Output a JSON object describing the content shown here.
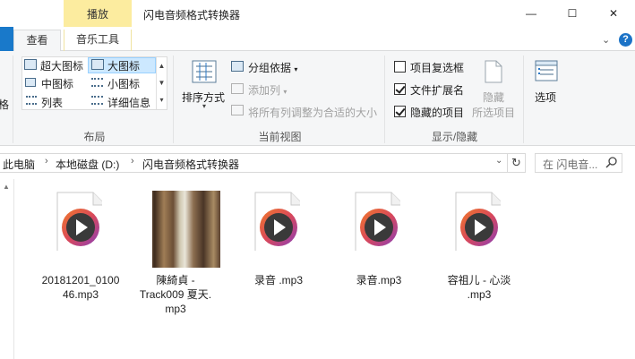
{
  "window": {
    "title": "闪电音频格式转换器",
    "context_tab": "播放",
    "min_symbol": "—",
    "max_symbol": "☐",
    "close_symbol": "✕"
  },
  "tabs": [
    {
      "label": "查看"
    },
    {
      "label": "音乐工具"
    }
  ],
  "ribbon": {
    "layout": {
      "label": "布局",
      "views": [
        "超大图标",
        "大图标",
        "中图标",
        "小图标",
        "列表",
        "详细信息"
      ],
      "selected": "大图标"
    },
    "current_view": {
      "label": "当前视图",
      "sort_by": "排序方式",
      "group_by": "分组依据",
      "add_column": "添加列",
      "fit_columns": "将所有列调整为合适的大小"
    },
    "show_hide": {
      "label": "显示/隐藏",
      "item_checkboxes": {
        "text": "项目复选框",
        "checked": false
      },
      "file_extensions": {
        "text": "文件扩展名",
        "checked": true
      },
      "hidden_items": {
        "text": "隐藏的项目",
        "checked": true
      },
      "hide_selected_line1": "隐藏",
      "hide_selected_line2": "所选项目"
    },
    "options": "选项",
    "left_cut_text": "格"
  },
  "address": {
    "crumbs": [
      "此电脑",
      "本地磁盘 (D:)",
      "闪电音频格式转换器"
    ],
    "search_placeholder": "在 闪电音..."
  },
  "files": [
    {
      "line1": "20181201_0100",
      "line2": "46.mp3",
      "line3": "",
      "type": "audio"
    },
    {
      "line1": "陳綺貞 -",
      "line2": "Track009 夏天.",
      "line3": "mp3",
      "type": "photo"
    },
    {
      "line1": "录音 .mp3",
      "line2": "",
      "line3": "",
      "type": "audio"
    },
    {
      "line1": "录音.mp3",
      "line2": "",
      "line3": "",
      "type": "audio"
    },
    {
      "line1": "容祖儿 - 心淡",
      "line2": ".mp3",
      "line3": "",
      "type": "audio"
    }
  ],
  "colors": {
    "context_tab_bg": "#fcec9f",
    "ribbon_bg": "#f5f6f7",
    "selected_view_bg": "#cce8ff",
    "play_circle_outer": "#e26a2c",
    "play_circle_inner": "#8a3fb8"
  }
}
